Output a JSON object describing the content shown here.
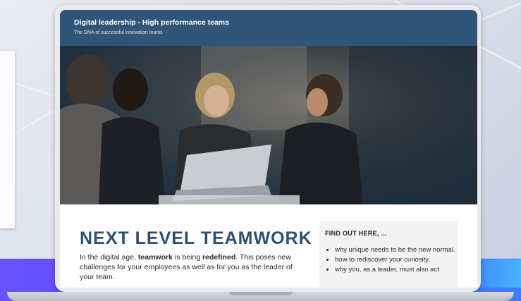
{
  "course": {
    "title": "Digital leadership - High performance teams",
    "subtitle": "The DNA of successful innovation teams"
  },
  "hero": {
    "description_alt": "Team of four colleagues in a dimly lit meeting, one holding a laptop"
  },
  "main": {
    "headline": "NEXT LEVEL TEAMWORK",
    "intro_parts": [
      "In the digital age, ",
      "teamwork",
      " is being ",
      "redefined",
      ". This poses new challenges for your employees as well as for you as the leader of your team."
    ]
  },
  "aside": {
    "title": "FIND OUT HERE, ...",
    "items": [
      "why unique needs to be the new normal.",
      "how to rediscover your curiosity.",
      "why you, as a leader, must also act"
    ]
  },
  "colors": {
    "header_bg": "#2f5579",
    "headline": "#2d4f6e",
    "band": "#5b4dff",
    "aside_bg": "#f3f3f3"
  }
}
